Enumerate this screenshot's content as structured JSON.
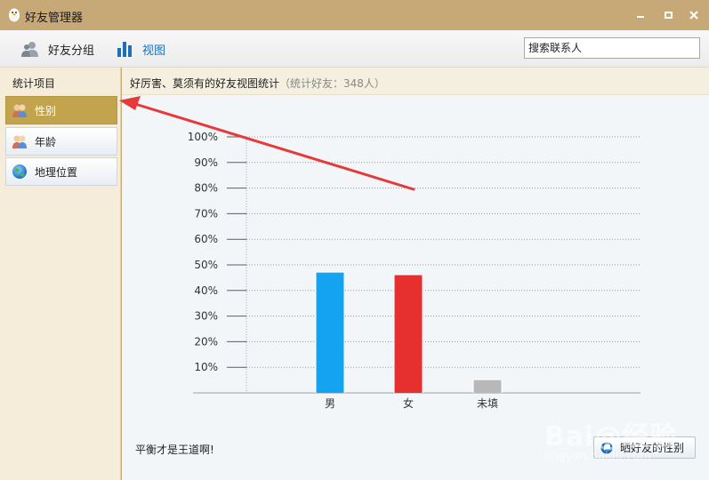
{
  "window": {
    "title": "好友管理器",
    "logo_icon": "penguin-icon",
    "controls": [
      "minimize-icon",
      "maximize-icon",
      "close-icon"
    ]
  },
  "toolbar": {
    "groups_label": "好友分组",
    "groups_icon": "people-icon",
    "view_label": "视图",
    "view_icon": "bar-chart-icon",
    "search_placeholder": "搜索联系人"
  },
  "sidebar": {
    "title": "统计项目",
    "items": [
      {
        "label": "性别",
        "icon": "people-pair-icon",
        "selected": true
      },
      {
        "label": "年龄",
        "icon": "people-pair-icon",
        "selected": false
      },
      {
        "label": "地理位置",
        "icon": "globe-icon",
        "selected": false
      }
    ]
  },
  "main": {
    "title": "好厉害、莫须有的好友视图统计",
    "subtitle": "（统计好友：348人）",
    "footer_text": "平衡才是王道啊!",
    "share_label": "晒好友的性别",
    "share_icon": "share-icon"
  },
  "colors": {
    "titlebar": "#c7a877",
    "sidebar_selected": "#c2a44e",
    "male_bar": "#13a3f0",
    "female_bar": "#e63030",
    "unknown_bar": "#b8b8b8",
    "annotation_arrow": "#e8393a"
  },
  "chart_data": {
    "type": "bar",
    "categories": [
      "男",
      "女",
      "未填"
    ],
    "values": [
      47,
      46,
      5
    ],
    "colors": [
      "#13a3f0",
      "#e63030",
      "#b8b8b8"
    ],
    "y_ticks": [
      "10%",
      "20%",
      "30%",
      "40%",
      "50%",
      "60%",
      "70%",
      "80%",
      "90%",
      "100%"
    ],
    "ylim": [
      0,
      100
    ],
    "grid": true
  },
  "watermark": {
    "main": "Bai@经验",
    "sub": "jingyan.baidu.com"
  }
}
